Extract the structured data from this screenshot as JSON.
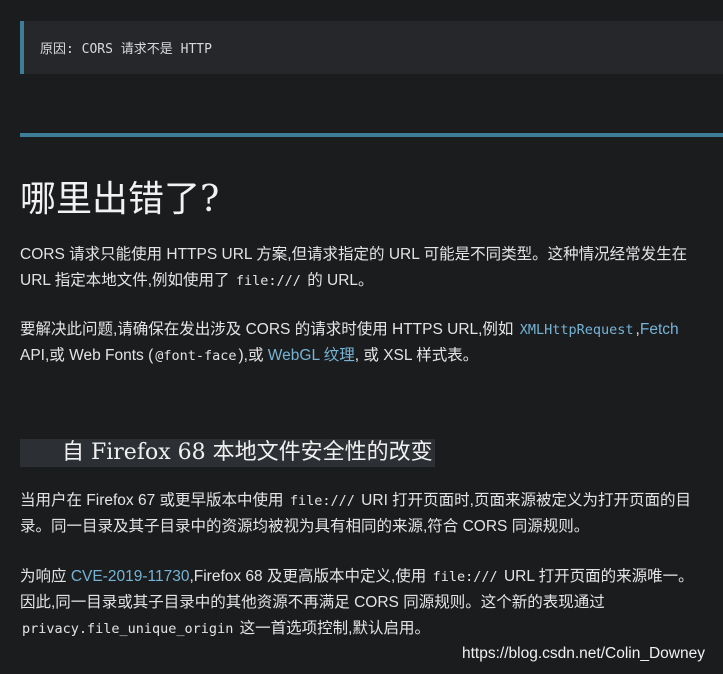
{
  "callout": {
    "text": "原因: CORS 请求不是 HTTP"
  },
  "heading": "哪里出错了?",
  "para1": {
    "t1": "CORS 请求只能使用 HTTPS URL 方案,但请求指定的 URL 可能是不同类型。这种情况经常发生在 URL 指定本地文件,例如使用了 ",
    "code1": "file:///",
    "t2": " 的 URL。"
  },
  "para2": {
    "t1": "要解决此问题,请确保在发出涉及 CORS 的请求时使用 HTTPS URL,例如 ",
    "link_xhr": "XMLHttpRequest",
    "t2": ",",
    "link_fetch": "Fetch",
    "t3": " API,或 Web Fonts (",
    "code_fontface": "@font-face",
    "t4": "),或 ",
    "link_webgl": "WebGL 纹理",
    "t5": ", 或 XSL 样式表。"
  },
  "subheading": "自 Firefox 68 本地文件安全性的改变",
  "para3": {
    "t1": "当用户在 Firefox 67 或更早版本中使用 ",
    "code1": "file:///",
    "t2": " URI 打开页面时,页面来源被定义为打开页面的目录。同一目录及其子目录中的资源均被视为具有相同的来源,符合 CORS 同源规则。"
  },
  "para4": {
    "t1": "为响应 ",
    "link_cve": "CVE-2019-11730",
    "t2": ",Firefox 68 及更高版本中定义,使用 ",
    "code1": "file:///",
    "t3": " URL 打开页面的来源唯一。 因此,同一目录或其子目录中的其他资源不再满足 CORS 同源规则。这个新的表现通过 ",
    "code2": "privacy.file_unique_origin",
    "t4": " 这一首选项控制,默认启用。"
  },
  "watermark": "https://blog.csdn.net/Colin_Downey",
  "colors": {
    "background": "#1b1c1e",
    "accent": "#3d7d97",
    "link": "#76b4d6"
  }
}
